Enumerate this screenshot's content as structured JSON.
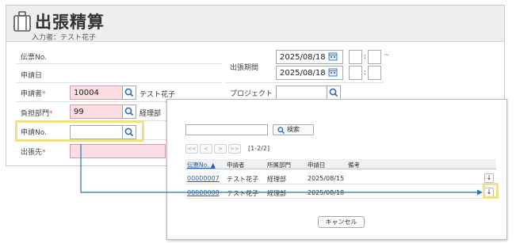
{
  "form": {
    "title": "出張精算",
    "subtitle": "入力者：テスト花子",
    "fields": {
      "denpyo_no": "伝票No.",
      "shinsei_bi": "申請日",
      "shinseisha": "申請者",
      "shinseisha_value": "10004",
      "shinseisha_name": "テスト花子",
      "futan_bumon": "負担部門",
      "futan_bumon_value": "99",
      "futan_bumon_name": "経理部",
      "shinsei_no": "申請No.",
      "shucchousaki": "出張先",
      "required_mark": "*"
    },
    "period": {
      "label": "出張期間",
      "start_date": "2025/08/18",
      "end_date": "2025/08/18",
      "colon": ":",
      "tilde": "~"
    },
    "project_label": "プロジェクト"
  },
  "popup": {
    "search_label": "検索",
    "pager": [
      "<<",
      "<",
      ">",
      ">>"
    ],
    "count": "[1-2/2]",
    "columns": [
      "伝票No. ▲",
      "申請者",
      "所属部門",
      "申請日",
      "備考"
    ],
    "rows": [
      [
        "00000007",
        "テスト花子",
        "経理部",
        "2025/08/15",
        ""
      ],
      [
        "00000008",
        "テスト花子",
        "経理部",
        "2025/08/18",
        ""
      ]
    ],
    "download_glyph": "↓",
    "cancel_label": "キャンセル"
  },
  "colors": {
    "highlight": "#f1e08a",
    "required_bg": "#fbdde3",
    "connector": "#1f77b4",
    "link": "#2a5db0"
  },
  "icons": [
    "briefcase-icon",
    "search-icon",
    "calendar-icon",
    "download-icon"
  ]
}
